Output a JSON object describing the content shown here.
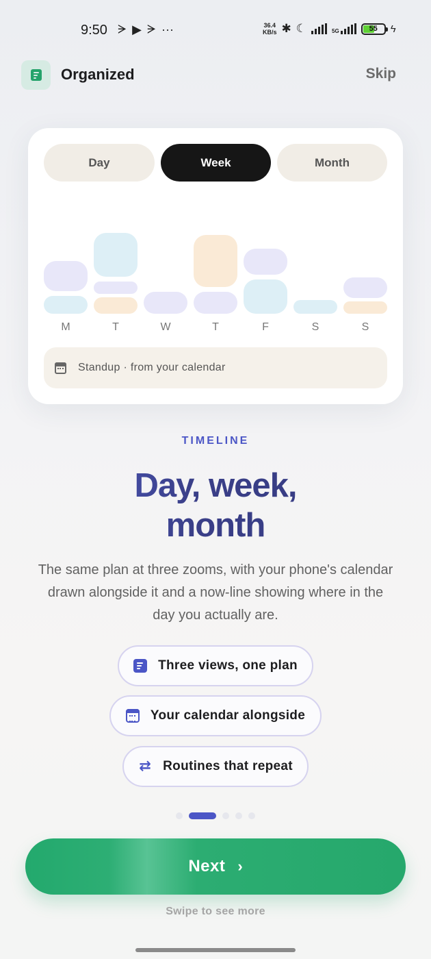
{
  "status_bar": {
    "time": "9:50",
    "net_speed_value": "36.4",
    "net_speed_unit": "KB/s",
    "network": "5G",
    "battery": "55",
    "battery_level": 0.55
  },
  "header": {
    "app_name": "Organized",
    "skip_label": "Skip"
  },
  "preview_card": {
    "tabs": [
      {
        "label": "Day",
        "active": false
      },
      {
        "label": "Week",
        "active": true
      },
      {
        "label": "Month",
        "active": false
      }
    ],
    "days": [
      "M",
      "T",
      "W",
      "T",
      "F",
      "S",
      "S"
    ],
    "calendar_note": "Standup · from your calendar"
  },
  "content": {
    "eyebrow": "TIMELINE",
    "headline_line1": "Day, week,",
    "headline_line2": "month",
    "description": "The same plan at three zooms, with your phone's calendar drawn alongside it and a now-line showing where in the day you actually are."
  },
  "features": [
    {
      "label": "Three views, one plan",
      "icon": "timeline-icon"
    },
    {
      "label": "Your calendar alongside",
      "icon": "calendar-icon"
    },
    {
      "label": "Routines that repeat",
      "icon": "repeat-icon"
    }
  ],
  "pagination": {
    "total": 5,
    "active": 1
  },
  "footer": {
    "next_label": "Next",
    "swipe_hint": "Swipe to see more"
  },
  "colors": {
    "accent_indigo": "#4b56c6",
    "brand_green": "#23a96d",
    "block_lavender": "#e8e7f9",
    "block_sky": "#ddeff6",
    "block_peach": "#faead6"
  }
}
